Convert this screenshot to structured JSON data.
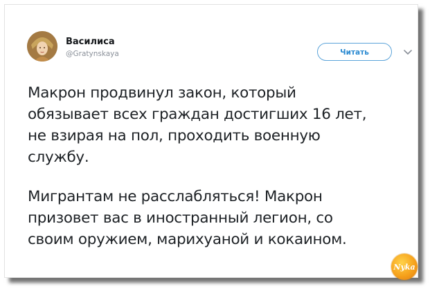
{
  "tweet": {
    "display_name": "Василиса",
    "handle": "@Gratynskaya",
    "follow_label": "Читать",
    "paragraphs": [
      "Макрон продвинул закон, который\nобязывает всех граждан достигших 16 лет,\nне взирая на пол, проходить военную\nслужбу.",
      "Мигрантам не расслабляться! Макрон\nпризовет вас в иностранный легион, со\nсвоим оружием, марихуаной и кокаином."
    ]
  },
  "icons": {
    "menu": "chevron-down-icon",
    "avatar": "avatar",
    "watermark": "logo"
  },
  "watermark_text": "Nyka",
  "colors": {
    "accent": "#2b8ad1",
    "text": "#1d2125",
    "secondary": "#8a9099",
    "watermark": "#f6a21c"
  }
}
